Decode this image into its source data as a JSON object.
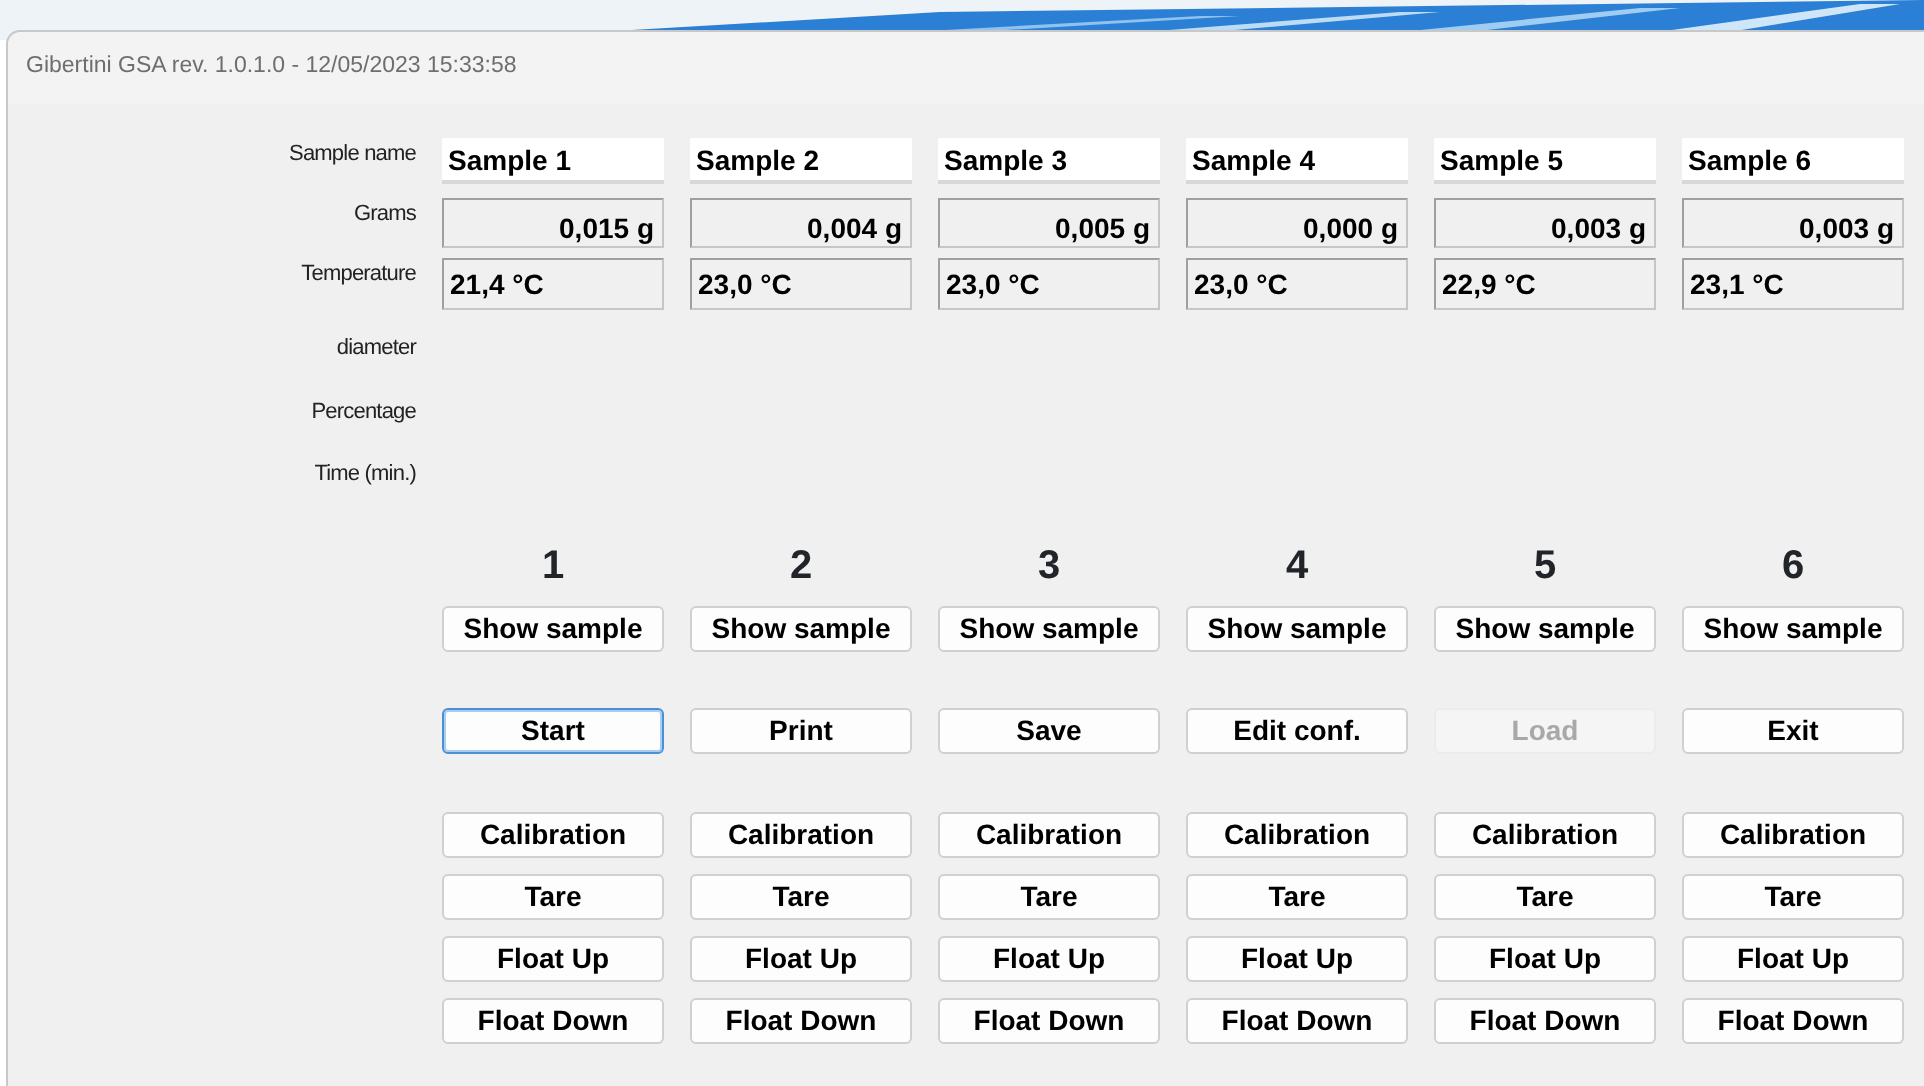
{
  "window": {
    "title": "Gibertini GSA rev. 1.0.1.0  - 12/05/2023 15:33:58"
  },
  "row_labels": [
    "Sample name",
    "Grams",
    "Temperature",
    "diameter",
    "Percentage",
    "Time (min.)"
  ],
  "samples": [
    {
      "name": "Sample 1",
      "grams": "0,015 g",
      "temperature": "21,4 °C",
      "number": "1",
      "show_button": "Show sample"
    },
    {
      "name": "Sample 2",
      "grams": "0,004 g",
      "temperature": "23,0 °C",
      "number": "2",
      "show_button": "Show sample"
    },
    {
      "name": "Sample 3",
      "grams": "0,005 g",
      "temperature": "23,0 °C",
      "number": "3",
      "show_button": "Show sample"
    },
    {
      "name": "Sample 4",
      "grams": "0,000 g",
      "temperature": "23,0 °C",
      "number": "4",
      "show_button": "Show sample"
    },
    {
      "name": "Sample 5",
      "grams": "0,003 g",
      "temperature": "22,9 °C",
      "number": "5",
      "show_button": "Show sample"
    },
    {
      "name": "Sample 6",
      "grams": "0,003 g",
      "temperature": "23,1 °C",
      "number": "6",
      "show_button": "Show sample"
    }
  ],
  "action_buttons": [
    {
      "label": "Start",
      "disabled": false,
      "focused": true
    },
    {
      "label": "Print",
      "disabled": false,
      "focused": false
    },
    {
      "label": "Save",
      "disabled": false,
      "focused": false
    },
    {
      "label": "Edit conf.",
      "disabled": false,
      "focused": false
    },
    {
      "label": "Load",
      "disabled": true,
      "focused": false
    },
    {
      "label": "Exit",
      "disabled": false,
      "focused": false
    }
  ],
  "control_rows": [
    [
      "Calibration",
      "Calibration",
      "Calibration",
      "Calibration",
      "Calibration",
      "Calibration"
    ],
    [
      "Tare",
      "Tare",
      "Tare",
      "Tare",
      "Tare",
      "Tare"
    ],
    [
      "Float Up",
      "Float Up",
      "Float Up",
      "Float Up",
      "Float Up",
      "Float Up"
    ],
    [
      "Float Down",
      "Float Down",
      "Float Down",
      "Float Down",
      "Float Down",
      "Float Down"
    ]
  ]
}
